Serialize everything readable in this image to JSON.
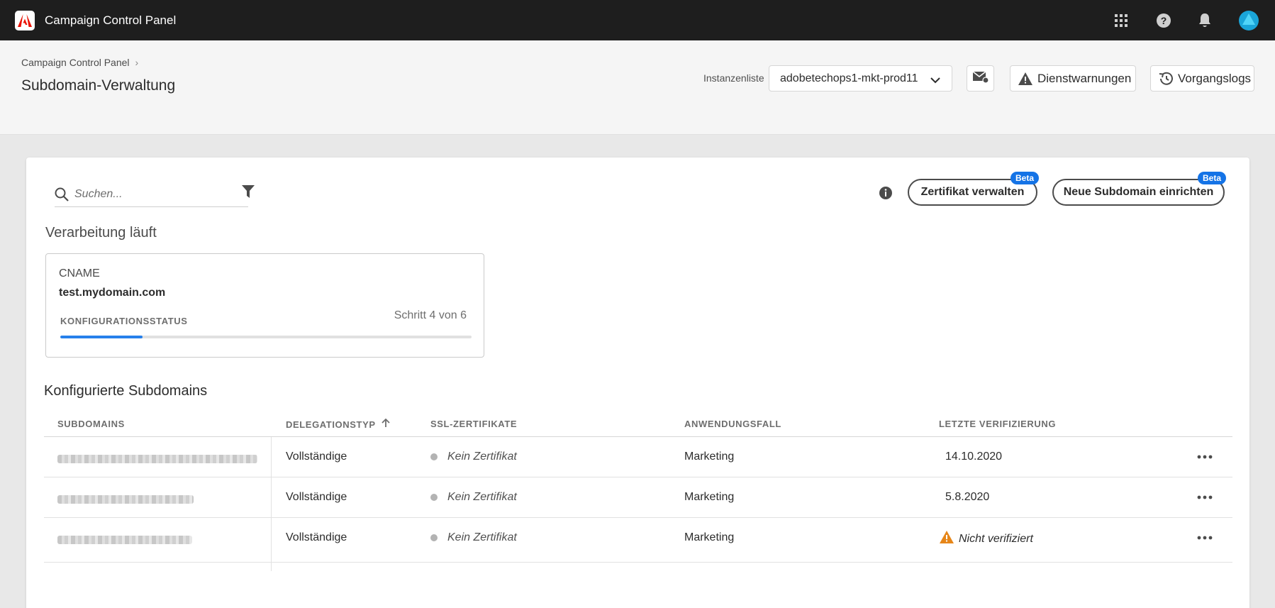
{
  "app": {
    "title": "Campaign Control Panel"
  },
  "breadcrumb": {
    "root": "Campaign Control Panel"
  },
  "page": {
    "title": "Subdomain-Verwaltung"
  },
  "instance": {
    "label": "Instanzenliste",
    "selected": "adobetechops1-mkt-prod11"
  },
  "header_buttons": {
    "warnings": "Dienstwarnungen",
    "logs": "Vorgangslogs"
  },
  "search": {
    "placeholder": "Suchen..."
  },
  "actions": {
    "manage_cert": "Zertifikat verwalten",
    "new_subdomain": "Neue Subdomain einrichten",
    "beta": "Beta"
  },
  "processing": {
    "title": "Verarbeitung läuft",
    "type": "CNAME",
    "host": "test.mydomain.com",
    "status_label": "KONFIGURATIONSSTATUS",
    "step_text": "Schritt 4 von 6",
    "progress_fraction": 0.2
  },
  "configured": {
    "title": "Konfigurierte Subdomains",
    "columns": {
      "subdomains": "SUBDOMAINS",
      "delegation": "DELEGATIONSTYP",
      "ssl": "SSL-ZERTIFIKATE",
      "usecase": "ANWENDUNGSFALL",
      "verified": "LETZTE VERIFIZIERUNG"
    },
    "rows": [
      {
        "delegation": "Vollständige",
        "ssl": "Kein Zertifikat",
        "usecase": "Marketing",
        "verified": "14.10.2020",
        "status": "ok"
      },
      {
        "delegation": "Vollständige",
        "ssl": "Kein Zertifikat",
        "usecase": "Marketing",
        "verified": "5.8.2020",
        "status": "ok"
      },
      {
        "delegation": "Vollständige",
        "ssl": "Kein Zertifikat",
        "usecase": "Marketing",
        "verified": "Nicht verifiziert",
        "status": "warning"
      }
    ]
  },
  "icons": {
    "apps": "apps-grid-icon",
    "help": "help-icon",
    "notifications": "bell-icon",
    "avatar": "avatar-icon"
  },
  "colors": {
    "topbar": "#1e1e1e",
    "accent": "#1473e6",
    "progress": "#2680eb",
    "warning": "#e68619",
    "adobe_red": "#eb1000"
  }
}
